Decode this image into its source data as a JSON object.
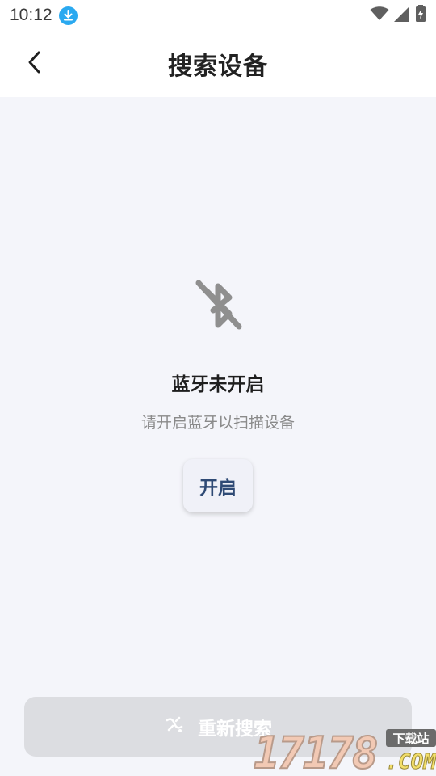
{
  "status_bar": {
    "time": "10:12",
    "icons": [
      "download-icon",
      "wifi-icon",
      "cell-signal-icon",
      "battery-charging-icon"
    ]
  },
  "header": {
    "title": "搜索设备",
    "back_icon": "chevron-left-icon"
  },
  "content": {
    "icon": "bluetooth-disabled-icon",
    "title": "蓝牙未开启",
    "description": "请开启蓝牙以扫描设备",
    "enable_label": "开启"
  },
  "footer": {
    "rescan_label": "重新搜索",
    "rescan_icon": "scan-icon",
    "rescan_disabled": true
  },
  "watermark": {
    "number": "17178",
    "badge": "下载站",
    "domain": ".COM"
  },
  "colors": {
    "accent_text": "#2f4a75",
    "download_badge": "#2aa9f0",
    "disabled_button": "#dcdde1",
    "background": "#f4f5fa"
  }
}
